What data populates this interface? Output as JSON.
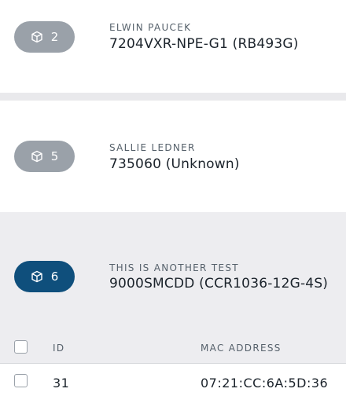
{
  "devices": [
    {
      "count": "2",
      "owner": "ELWIN PAUCEK",
      "device": "7204VXR-NPE-G1 (RB493G)"
    },
    {
      "count": "5",
      "owner": "SALLIE LEDNER",
      "device": "735060 (Unknown)"
    },
    {
      "count": "6",
      "owner": "THIS IS ANOTHER TEST",
      "device": "9000SMCDD (CCR1036-12G-4S)"
    }
  ],
  "table": {
    "headers": {
      "id": "ID",
      "mac": "MAC ADDRESS"
    },
    "rows": [
      {
        "id": "31",
        "mac": "07:21:CC:6A:5D:36"
      }
    ]
  },
  "icons": {
    "badge": "box-icon"
  },
  "colors": {
    "active_badge": "#0f4f7c",
    "muted_badge": "#9aa1a9"
  }
}
